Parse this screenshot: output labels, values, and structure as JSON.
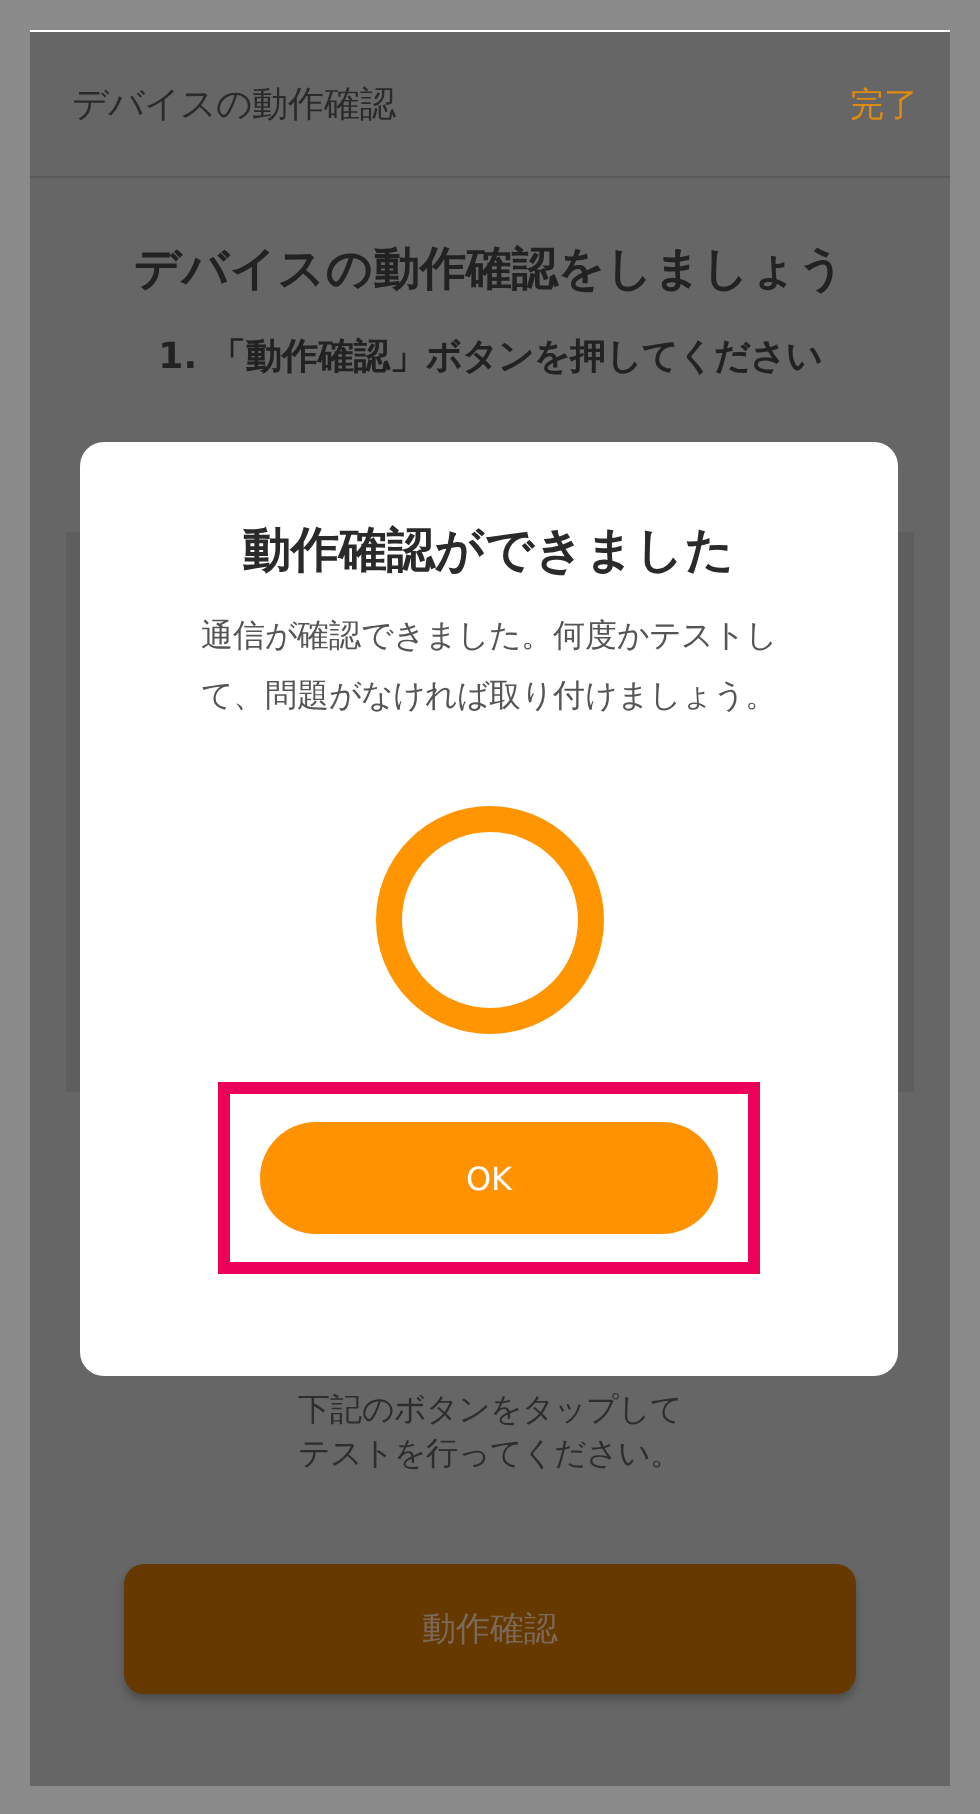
{
  "header": {
    "title": "デバイスの動作確認",
    "action": "完了"
  },
  "heading": "デバイスの動作確認をしましょう",
  "steps": [
    "1. 「動作確認」ボタンを押してください"
  ],
  "instruction_lines": [
    "下記のボタンをタップして",
    "テストを行ってください。"
  ],
  "primary_button": "動作確認",
  "dialog": {
    "title": "動作確認ができました",
    "message_lines": [
      "通信が確認できました。何度かテストし",
      "て、問題がなければ取り付けましょう。"
    ],
    "ok_button": "OK",
    "highlighted": true
  }
}
